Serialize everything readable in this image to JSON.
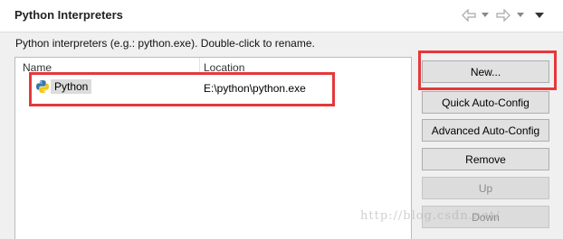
{
  "header": {
    "title": "Python Interpreters",
    "nav_icons": [
      "back-arrow-icon",
      "dropdown-icon",
      "forward-arrow-icon",
      "dropdown-icon",
      "view-menu-icon"
    ]
  },
  "description": "Python interpreters (e.g.: python.exe).   Double-click to rename.",
  "table": {
    "columns": [
      "Name",
      "Location"
    ],
    "rows": [
      {
        "name": "Python",
        "location": "E:\\python\\python.exe",
        "icon": "python-icon"
      }
    ]
  },
  "buttons": {
    "new": "New...",
    "quick_auto_config": "Quick Auto-Config",
    "advanced_auto_config": "Advanced Auto-Config",
    "remove": "Remove",
    "up": "Up",
    "down": "Down"
  },
  "watermark": "http://blog.csdn.net/",
  "colors": {
    "highlight_box": "#e5383b",
    "selected_row": "#dcdcdc"
  }
}
